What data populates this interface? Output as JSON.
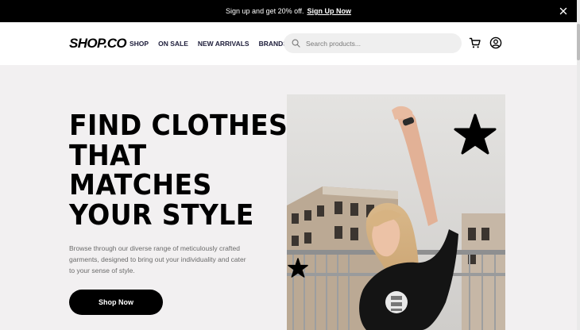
{
  "promo": {
    "text": "Sign up and get 20% off.",
    "cta": "Sign Up Now"
  },
  "header": {
    "logo": "SHOP.CO",
    "nav": [
      "SHOP",
      "ON SALE",
      "NEW ARRIVALS",
      "BRANDS"
    ],
    "search_placeholder": "Search products...",
    "icons": [
      "search-icon",
      "cart-icon",
      "account-icon"
    ]
  },
  "hero": {
    "headline": [
      "FIND CLOTHES",
      "THAT",
      "MATCHES",
      "YOUR STYLE"
    ],
    "subtitle": "Browse through our diverse range of meticulously crafted garments, designed to bring out your individuality and cater to your sense of style.",
    "button": "Shop Now",
    "decorations": [
      "star-icon",
      "star-icon"
    ]
  },
  "colors": {
    "promo_bg": "#000000",
    "hero_bg": "#f2f0f1",
    "button_bg": "#000000",
    "search_bg": "#efefef",
    "subtitle_text": "#6b6b6b"
  }
}
